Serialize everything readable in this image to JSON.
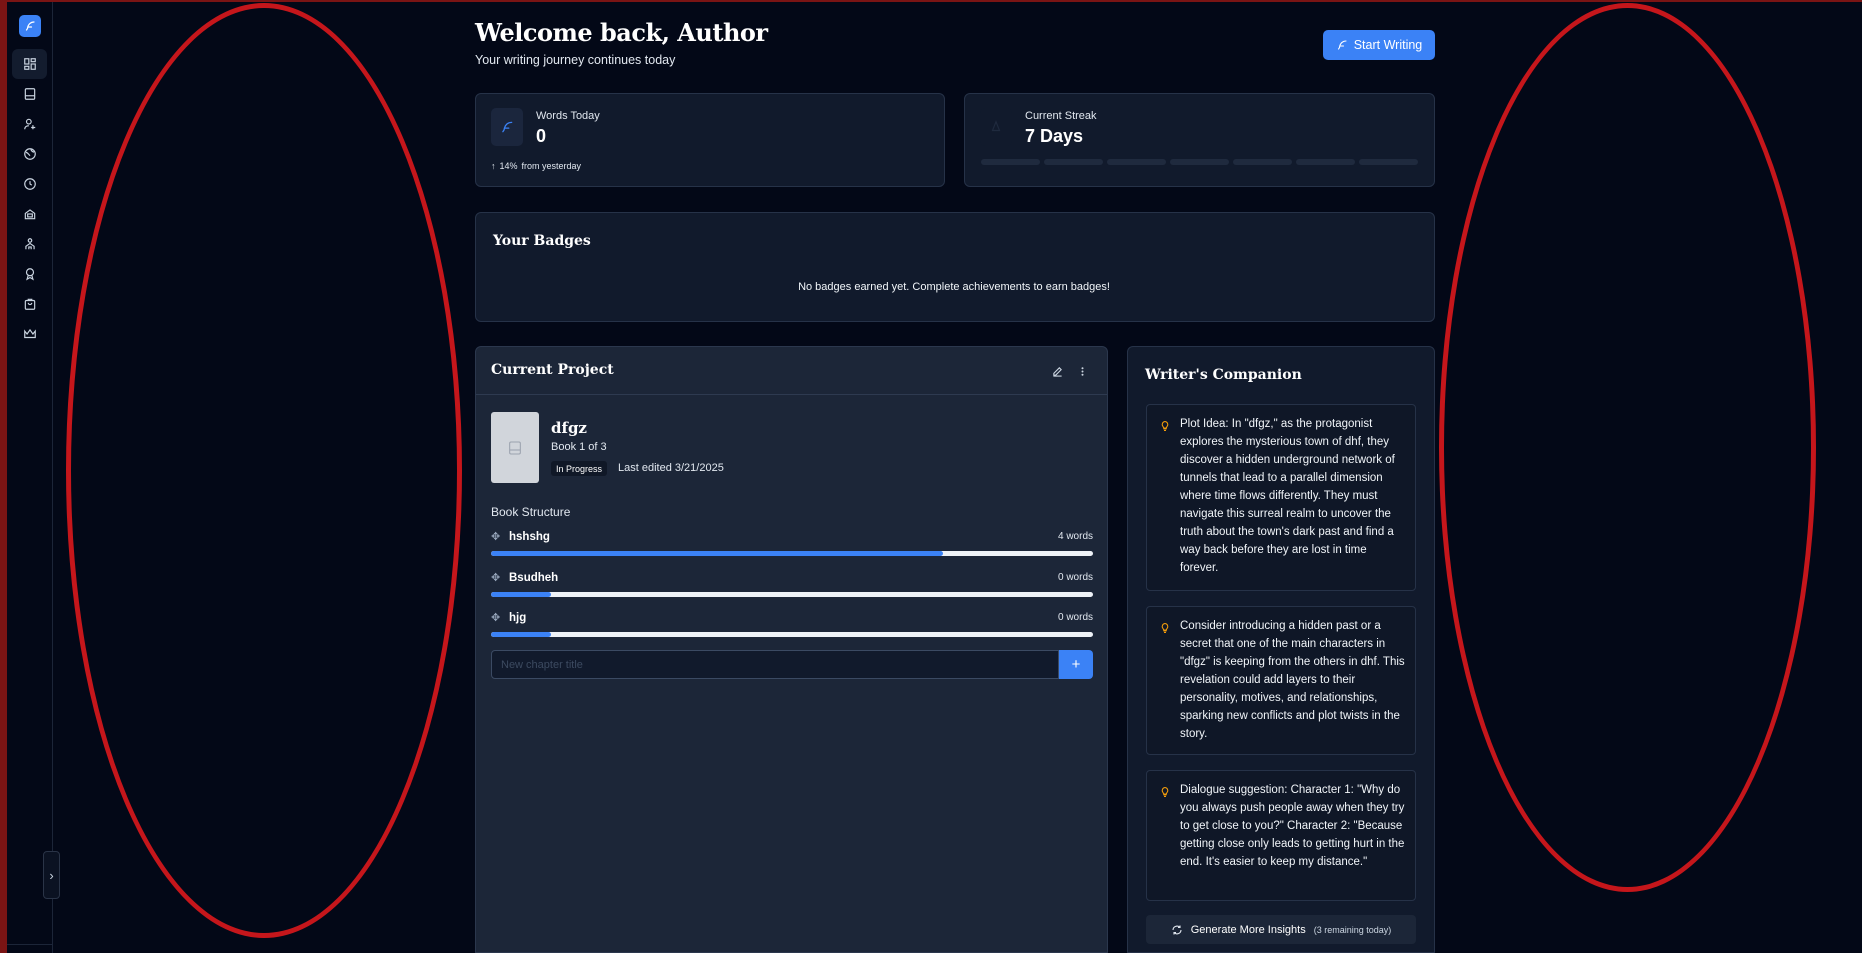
{
  "header": {
    "title": "Welcome back, Author",
    "subtitle": "Your writing journey continues today",
    "start_writing_label": "Start Writing"
  },
  "sidebar": {
    "items": [
      {
        "icon": "dashboard-icon",
        "active": true
      },
      {
        "icon": "book-icon",
        "active": false
      },
      {
        "icon": "user-plus-icon",
        "active": false
      },
      {
        "icon": "globe-icon",
        "active": false
      },
      {
        "icon": "clock-icon",
        "active": false
      },
      {
        "icon": "robot-icon",
        "active": false
      },
      {
        "icon": "community-icon",
        "active": false
      },
      {
        "icon": "award-icon",
        "active": false
      },
      {
        "icon": "shopping-bag-icon",
        "active": false
      },
      {
        "icon": "crown-icon",
        "active": false
      }
    ],
    "collapse_glyph": "›"
  },
  "stats": {
    "words_today": {
      "label": "Words Today",
      "value": "0",
      "change_pct": "14%",
      "change_text": "from yesterday"
    },
    "streak": {
      "label": "Current Streak",
      "value": "7 Days",
      "days_filled": 0,
      "days_total": 7
    }
  },
  "badges": {
    "title": "Your Badges",
    "empty_text": "No badges earned yet. Complete achievements to earn badges!"
  },
  "project": {
    "title": "Current Project",
    "book_title": "dfgz",
    "book_of": "Book 1 of 3",
    "status": "In Progress",
    "last_edited": "Last edited 3/21/2025",
    "structure_label": "Book Structure",
    "chapters": [
      {
        "name": "hshshg",
        "words": "4 words",
        "progress": 0.75
      },
      {
        "name": "Bsudheh",
        "words": "0 words",
        "progress": 0.1
      },
      {
        "name": "hjg",
        "words": "0 words",
        "progress": 0.1
      }
    ],
    "new_chapter_placeholder": "New chapter title",
    "add_chapter_glyph": "+"
  },
  "companion": {
    "title": "Writer's Companion",
    "insights": [
      "Plot Idea: In \"dfgz,\" as the protagonist explores the mysterious town of dhf, they discover a hidden underground network of tunnels that lead to a parallel dimension where time flows differently. They must navigate this surreal realm to uncover the truth about the town's dark past and find a way back before they are lost in time forever.",
      "Consider introducing a hidden past or a secret that one of the main characters in \"dfgz\" is keeping from the others in dhf. This revelation could add layers to their personality, motives, and relationships, sparking new conflicts and plot twists in the story.",
      "Dialogue suggestion: Character 1: \"Why do you always push people away when they try to get close to you?\" Character 2: \"Because getting close only leads to getting hurt in the end. It's easier to keep my distance.\""
    ],
    "generate_label": "Generate More Insights",
    "remaining_label": "(3 remaining today)"
  },
  "colors": {
    "accent": "#3b82f6",
    "background": "#030817",
    "card": "#111a2c",
    "annotation": "#c5161b"
  }
}
